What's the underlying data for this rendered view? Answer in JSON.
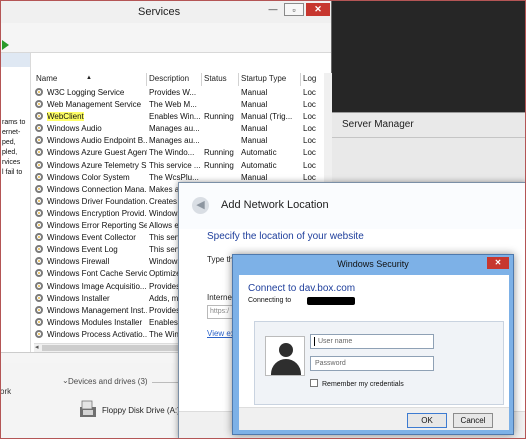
{
  "server_manager": {
    "title": "Server Manager"
  },
  "services_window": {
    "title": "Services",
    "left_pane_fragments": [
      "rams to",
      "ernet-",
      "ped,",
      "pled,",
      "rvices",
      "l fail to"
    ],
    "columns": {
      "name": "Name",
      "description": "Description",
      "status": "Status",
      "startup_type": "Startup Type",
      "log_on_as": "Log"
    },
    "rows": [
      {
        "name": "W3C Logging Service",
        "description": "Provides W...",
        "status": "",
        "startup_type": "Manual",
        "log_on_as": "Loc"
      },
      {
        "name": "Web Management Service",
        "description": "The Web M...",
        "status": "",
        "startup_type": "Manual",
        "log_on_as": "Loc"
      },
      {
        "name": "WebClient",
        "description": "Enables Win...",
        "status": "Running",
        "startup_type": "Manual (Trig...",
        "log_on_as": "Loc"
      },
      {
        "name": "Windows Audio",
        "description": "Manages au...",
        "status": "",
        "startup_type": "Manual",
        "log_on_as": "Loc"
      },
      {
        "name": "Windows Audio Endpoint B...",
        "description": "Manages au...",
        "status": "",
        "startup_type": "Manual",
        "log_on_as": "Loc"
      },
      {
        "name": "Windows Azure Guest Agent",
        "description": "The Windo...",
        "status": "Running",
        "startup_type": "Automatic",
        "log_on_as": "Loc"
      },
      {
        "name": "Windows Azure Telemetry S...",
        "description": "This service ...",
        "status": "Running",
        "startup_type": "Automatic",
        "log_on_as": "Loc"
      },
      {
        "name": "Windows Color System",
        "description": "The WcsPlu...",
        "status": "",
        "startup_type": "Manual",
        "log_on_as": "Loc"
      },
      {
        "name": "Windows Connection Mana...",
        "description": "Makes auto...",
        "status": "",
        "startup_type": "",
        "log_on_as": ""
      },
      {
        "name": "Windows Driver Foundation...",
        "description": "Creates and ...",
        "status": "",
        "startup_type": "",
        "log_on_as": ""
      },
      {
        "name": "Windows Encryption Provid...",
        "description": "Windows E...",
        "status": "",
        "startup_type": "",
        "log_on_as": ""
      },
      {
        "name": "Windows Error Reporting Se...",
        "description": "Allows error...",
        "status": "",
        "startup_type": "",
        "log_on_as": ""
      },
      {
        "name": "Windows Event Collector",
        "description": "This service ...",
        "status": "",
        "startup_type": "",
        "log_on_as": ""
      },
      {
        "name": "Windows Event Log",
        "description": "This service ...",
        "status": "",
        "startup_type": "",
        "log_on_as": ""
      },
      {
        "name": "Windows Firewall",
        "description": "Windows Fi...",
        "status": "",
        "startup_type": "",
        "log_on_as": ""
      },
      {
        "name": "Windows Font Cache Service",
        "description": "Optimizes p...",
        "status": "",
        "startup_type": "",
        "log_on_as": ""
      },
      {
        "name": "Windows Image Acquisitio...",
        "description": "Provides im...",
        "status": "",
        "startup_type": "",
        "log_on_as": ""
      },
      {
        "name": "Windows Installer",
        "description": "Adds, modi...",
        "status": "",
        "startup_type": "",
        "log_on_as": ""
      },
      {
        "name": "Windows Management Inst...",
        "description": "Provides a c...",
        "status": "",
        "startup_type": "",
        "log_on_as": ""
      },
      {
        "name": "Windows Modules Installer",
        "description": "Enables inst...",
        "status": "",
        "startup_type": "",
        "log_on_as": ""
      },
      {
        "name": "Windows Process Activatio...",
        "description": "The Windo...",
        "status": "",
        "startup_type": "",
        "log_on_as": ""
      }
    ],
    "selected_row": "WebClient"
  },
  "explorer": {
    "section_heading": "Devices and drives (3)",
    "left_fragment": "ork",
    "drive_label": "Floppy Disk Drive (A:)"
  },
  "add_network_location": {
    "title": "Add Network Location",
    "heading": "Specify the location of your website",
    "type_text": "Type the",
    "internet_label": "Internet",
    "address_placeholder": "https:/",
    "view_examples_link": "View ex"
  },
  "windows_security": {
    "title": "Windows Security",
    "close_label": "✕",
    "connect_heading": "Connect to dav.box.com",
    "connecting_text": "Connecting to",
    "username_placeholder": "User name",
    "password_placeholder": "Password",
    "remember_label": "Remember my credentials",
    "ok_label": "OK",
    "cancel_label": "Cancel"
  },
  "colors": {
    "selection_highlight": "#ffff66",
    "dialog_frame": "#7db1e7",
    "heading_blue": "#1f3f9c",
    "close_red": "#c7372f"
  },
  "icons": {
    "service": "gear-icon",
    "back": "back-arrow-icon",
    "user": "user-avatar-icon",
    "drive": "floppy-drive-icon"
  }
}
